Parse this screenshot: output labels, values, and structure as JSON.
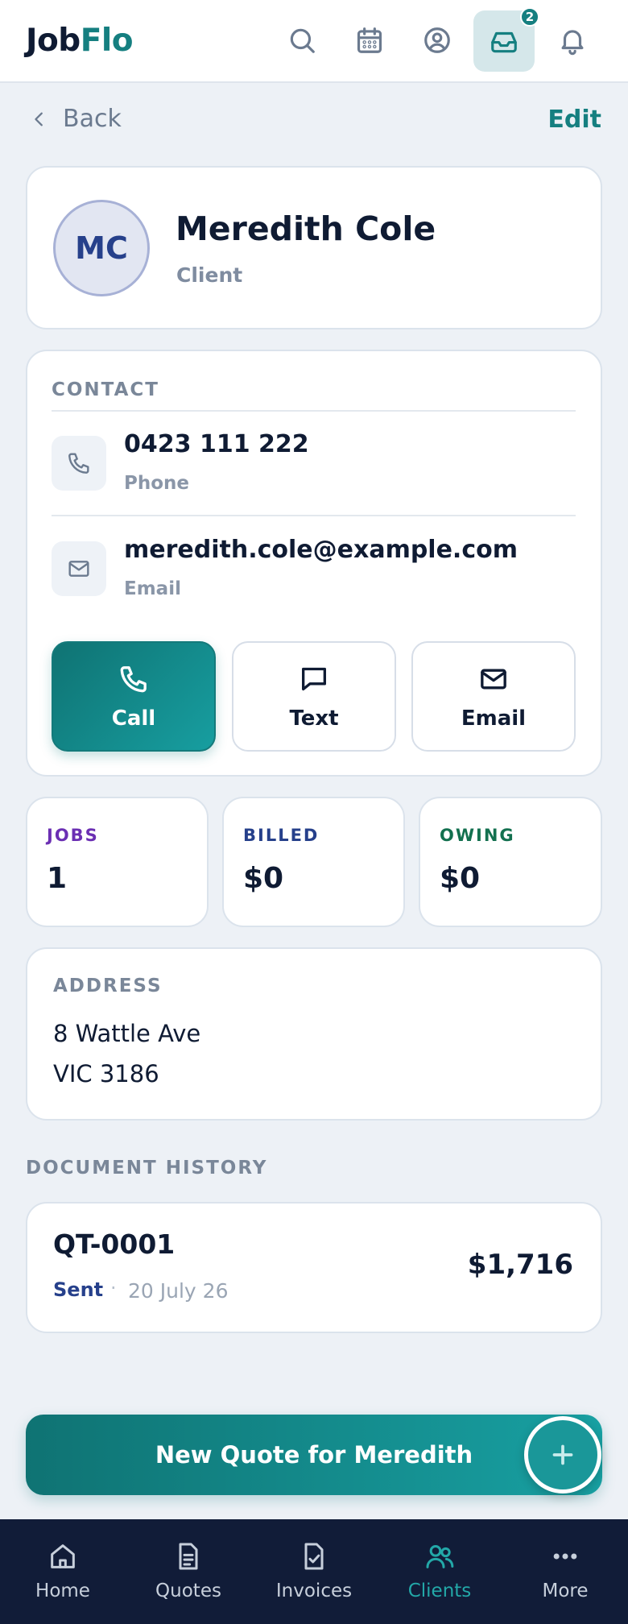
{
  "header": {
    "logo_part1": "Job",
    "logo_part2": "Flo",
    "icons": [
      "search-icon",
      "calendar-icon",
      "user-circle-icon",
      "inbox-icon",
      "bell-icon"
    ],
    "inbox_badge": "2"
  },
  "nav_row": {
    "back_label": "Back",
    "edit_label": "Edit"
  },
  "profile": {
    "initials": "MC",
    "name": "Meredith Cole",
    "role": "Client"
  },
  "contact": {
    "section_label": "CONTACT",
    "phone": {
      "value": "0423 111 222",
      "label": "Phone"
    },
    "email": {
      "value": "meredith.cole@example.com",
      "label": "Email"
    },
    "actions": {
      "call": "Call",
      "text": "Text",
      "email": "Email"
    }
  },
  "stats": {
    "jobs": {
      "label": "JOBS",
      "value": "1",
      "color": "#6b2fb3"
    },
    "billed": {
      "label": "BILLED",
      "value": "$0",
      "color": "#26408b"
    },
    "owing": {
      "label": "OWING",
      "value": "$0",
      "color": "#13704f"
    }
  },
  "address": {
    "section_label": "ADDRESS",
    "line1": "8 Wattle Ave",
    "line2": "VIC 3186"
  },
  "document_history": {
    "section_label": "DOCUMENT HISTORY",
    "items": [
      {
        "id": "QT-0001",
        "status": "Sent",
        "separator": "·",
        "date": "20 July 26",
        "amount": "$1,716"
      }
    ]
  },
  "new_quote": {
    "label": "New Quote for Meredith"
  },
  "bottom_nav": {
    "items": [
      {
        "label": "Home",
        "icon": "home-icon"
      },
      {
        "label": "Quotes",
        "icon": "document-icon"
      },
      {
        "label": "Invoices",
        "icon": "invoice-check-icon"
      },
      {
        "label": "Clients",
        "icon": "users-icon",
        "active": true
      },
      {
        "label": "More",
        "icon": "more-dots-icon"
      }
    ]
  },
  "colors": {
    "brand": "#157f80",
    "navy": "#111c38",
    "background": "#edf1f6"
  }
}
